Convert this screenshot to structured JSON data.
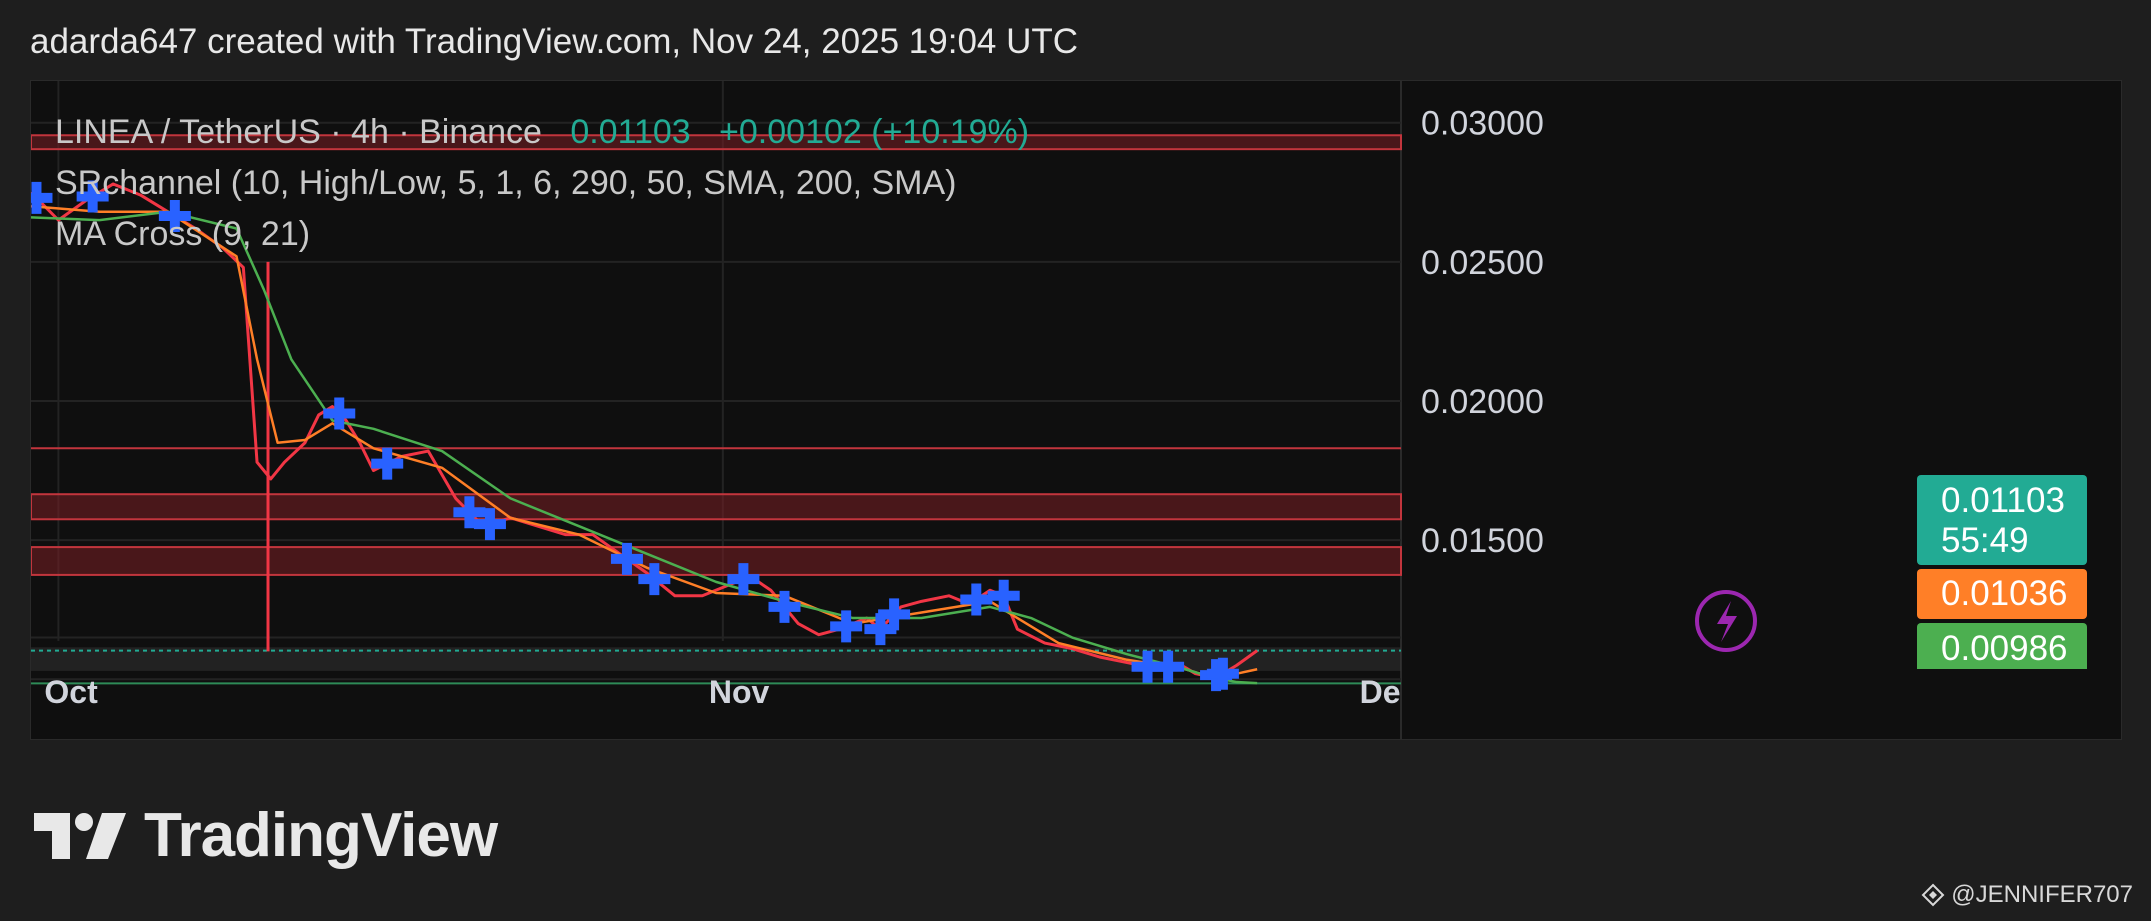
{
  "header": "adarda647 created with TradingView.com, Nov 24, 2025 19:04 UTC",
  "legend": {
    "symbol": "LINEA / TetherUS · 4h · Binance",
    "last": "0.01103",
    "change": "+0.00102 (+10.19%)",
    "indicator1": "SRchannel (10, High/Low, 5, 1, 6, 290, 50, SMA, 200, SMA)",
    "indicator2": "MA Cross (9, 21)"
  },
  "badges": {
    "last_price": "0.01103",
    "countdown": "55:49",
    "ma_fast": "0.01036",
    "ma_slow": "0.00986"
  },
  "colors": {
    "up": "#22ab94",
    "down": "#f23645",
    "ma_fast": "#ff7f27",
    "ma_slow": "#4caf50",
    "marker": "#2962ff",
    "zone": "#7a1f24",
    "lightning": "#9c27b0"
  },
  "logo": {
    "text": "TradingView",
    "icon": "tradingview-logo-icon"
  },
  "watermark": {
    "text": "@JENNIFER707",
    "icon": "binance-diamond-icon"
  },
  "chart_data": {
    "type": "line",
    "title": "LINEA / TetherUS · 4h · Binance",
    "y_ticks": [
      "0.03000",
      "0.02500",
      "0.02000",
      "0.01500"
    ],
    "y_tick_values": [
      0.03,
      0.025,
      0.02,
      0.015
    ],
    "x_ticks": [
      "Oct",
      "Nov",
      "De"
    ],
    "ylim": [
      0.0085,
      0.0315
    ],
    "xlim": [
      0,
      100
    ],
    "x_tick_positions": [
      2,
      50.5,
      98
    ],
    "grid": true,
    "series": [
      {
        "key": "price",
        "x": [
          0,
          2,
          4,
          6,
          8,
          10,
          12,
          14,
          15.5,
          16.5,
          17.5,
          18.5,
          20,
          21,
          22,
          23,
          24,
          25,
          27,
          29,
          31,
          33,
          35,
          37,
          39,
          41,
          43,
          45,
          47,
          49,
          51,
          52.5,
          54,
          56,
          57.5,
          59,
          61,
          62,
          63.5,
          65,
          67,
          68.5,
          70,
          71,
          72,
          74,
          76,
          78,
          80,
          82,
          84,
          85,
          86,
          87,
          88,
          89.5
        ],
        "values": [
          0.0275,
          0.0265,
          0.0272,
          0.0278,
          0.0274,
          0.0268,
          0.0262,
          0.0255,
          0.0248,
          0.0178,
          0.0172,
          0.0178,
          0.0185,
          0.0195,
          0.0198,
          0.0193,
          0.0185,
          0.0175,
          0.018,
          0.0182,
          0.0165,
          0.0155,
          0.0158,
          0.0155,
          0.0152,
          0.0152,
          0.0145,
          0.0138,
          0.013,
          0.013,
          0.0134,
          0.0137,
          0.0132,
          0.012,
          0.0116,
          0.0118,
          0.0122,
          0.0118,
          0.0126,
          0.0128,
          0.013,
          0.0127,
          0.0132,
          0.013,
          0.0118,
          0.0113,
          0.0111,
          0.0108,
          0.0106,
          0.0104,
          0.0105,
          0.0102,
          0.0101,
          0.0102,
          0.0105,
          0.01103
        ]
      },
      {
        "key": "ma_fast",
        "x": [
          0,
          5,
          10,
          15,
          16.5,
          18,
          20,
          22,
          25,
          30,
          35,
          40,
          45,
          50,
          55,
          60,
          65,
          70,
          72,
          75,
          80,
          84,
          86,
          88,
          89.5
        ],
        "values": [
          0.027,
          0.0268,
          0.0268,
          0.0252,
          0.0215,
          0.0185,
          0.0186,
          0.0192,
          0.0183,
          0.0176,
          0.0158,
          0.0152,
          0.014,
          0.0131,
          0.013,
          0.012,
          0.0124,
          0.0128,
          0.0122,
          0.0113,
          0.0107,
          0.0104,
          0.0101,
          0.0102,
          0.01036
        ]
      },
      {
        "key": "ma_slow",
        "x": [
          0,
          5,
          10,
          15,
          17,
          19,
          22,
          25,
          30,
          35,
          40,
          45,
          50,
          55,
          60,
          65,
          70,
          73,
          76,
          80,
          84,
          86,
          88,
          89.5
        ],
        "values": [
          0.0266,
          0.0265,
          0.0268,
          0.0262,
          0.024,
          0.0215,
          0.0193,
          0.019,
          0.0182,
          0.0165,
          0.0155,
          0.0145,
          0.0135,
          0.0128,
          0.0122,
          0.0122,
          0.0126,
          0.0122,
          0.0115,
          0.0109,
          0.0104,
          0.0101,
          0.0099,
          0.00986
        ]
      }
    ],
    "wicks": [
      {
        "x": 17.3,
        "high": 0.025,
        "low": 0.011
      }
    ],
    "markers_x": [
      0.4,
      4.5,
      10.5,
      22.5,
      26,
      32,
      33.5,
      43.5,
      45.5,
      52,
      55,
      59.5,
      62,
      63,
      69,
      71,
      81.5,
      83,
      86.5,
      87
    ]
  }
}
